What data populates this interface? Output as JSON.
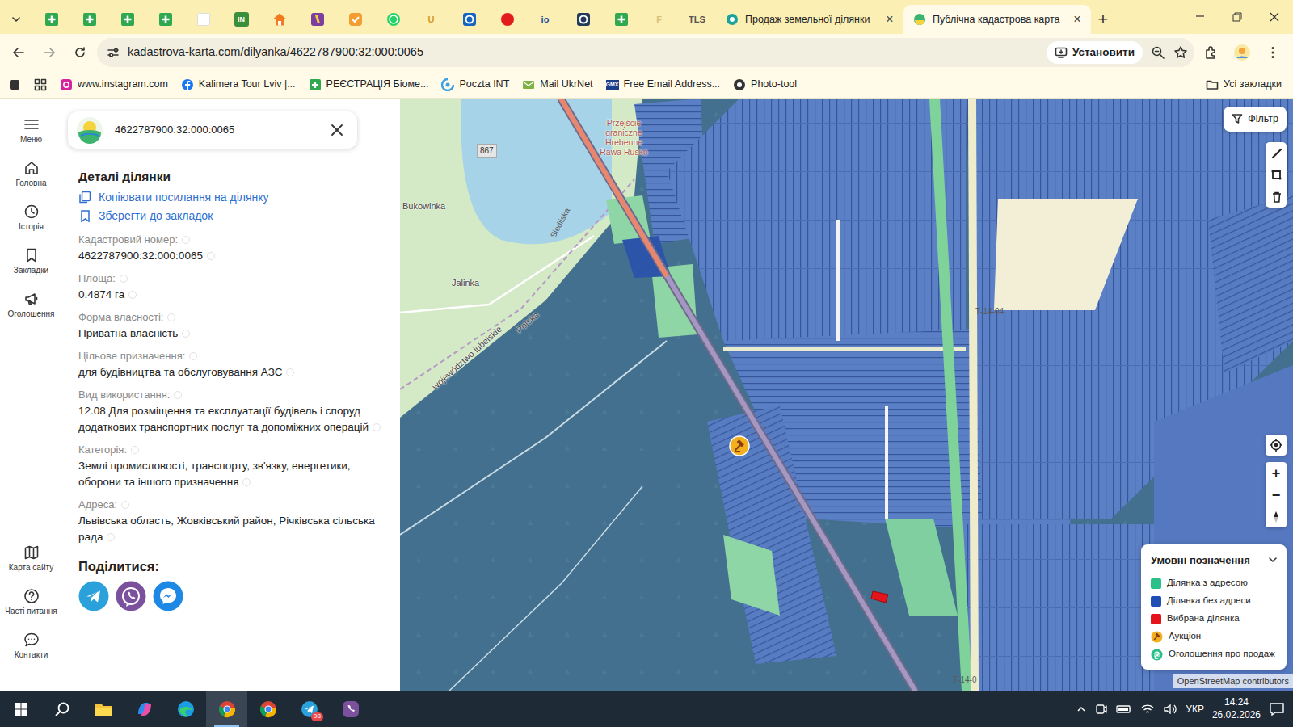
{
  "browser": {
    "pinned_tabs": [
      {
        "kind": "plus",
        "color": "#2fa84f"
      },
      {
        "kind": "plus",
        "color": "#2fa84f"
      },
      {
        "kind": "plus",
        "color": "#2fa84f"
      },
      {
        "kind": "plus",
        "color": "#2fa84f"
      },
      {
        "kind": "blank",
        "color": "#ffffff"
      },
      {
        "kind": "tile",
        "label": "IN",
        "color": "#3a8f3a"
      },
      {
        "kind": "house",
        "color": "#f47a20"
      },
      {
        "kind": "badge",
        "color": "#7b3fa0"
      },
      {
        "kind": "check",
        "color": "#f39c32"
      },
      {
        "kind": "chat",
        "color": "#25d366"
      },
      {
        "kind": "text",
        "label": "U",
        "color": "#d99a1a"
      },
      {
        "kind": "ring",
        "color": "#1565c0"
      },
      {
        "kind": "dot",
        "color": "#e31b1b"
      },
      {
        "kind": "text",
        "label": "io",
        "color": "#1a4fa0"
      },
      {
        "kind": "ring",
        "color": "#233a5a"
      },
      {
        "kind": "plus",
        "color": "#2fa84f"
      },
      {
        "kind": "text",
        "label": "F",
        "color": "#d9c07a"
      },
      {
        "kind": "text",
        "label": "TLS",
        "color": "#555555"
      }
    ],
    "tabs": [
      {
        "label": "Продаж земельної ділянки",
        "close": "×",
        "kind": "sale-site",
        "selected": false
      },
      {
        "label": "Публічна кадастрова карта",
        "close": "×",
        "kind": "cadastre",
        "selected": true
      }
    ],
    "new_tab": "+",
    "address": "kadastrova-karta.com/dilyanka/4622787900:32:000:0065",
    "install_button": "Установити",
    "bookmarks": [
      {
        "label": "www.instagram.com",
        "kind": "instagram",
        "color": "#d6249f"
      },
      {
        "label": "Kalimera Tour Lviv |...",
        "kind": "facebook",
        "color": "#1877f2"
      },
      {
        "label": "РЕЄСТРАЦІЯ Біоме...",
        "kind": "plus",
        "color": "#2fa84f"
      },
      {
        "label": "Poczta INT",
        "kind": "swirl",
        "color": "#3ba0e6"
      },
      {
        "label": "Mail UkrNet",
        "kind": "mail",
        "color": "#7cb342"
      },
      {
        "label": "Free Email Address...",
        "kind": "gmx",
        "icon_text": "GMX",
        "color": "#1c3e8a"
      },
      {
        "label": "Photo-tool",
        "kind": "dark",
        "color": "#333333"
      }
    ],
    "all_bookmarks": "Усі закладки"
  },
  "nav": {
    "top": [
      {
        "label": "Меню",
        "kind": "menu"
      },
      {
        "label": "Головна",
        "kind": "home"
      },
      {
        "label": "Історія",
        "kind": "history"
      },
      {
        "label": "Закладки",
        "kind": "bookmark"
      },
      {
        "label": "Оголошення",
        "kind": "announce"
      }
    ],
    "bottom": [
      {
        "label": "Карта сайту",
        "kind": "sitemap"
      },
      {
        "label": "Часті питання",
        "kind": "faq"
      },
      {
        "label": "Контакти",
        "kind": "contacts"
      }
    ]
  },
  "panel": {
    "search_value": "4622787900:32:000:0065",
    "title": "Деталі ділянки",
    "actions": [
      {
        "label": "Копіювати посилання на ділянку",
        "kind": "copy"
      },
      {
        "label": "Зберегти до закладок",
        "kind": "bookmark"
      }
    ],
    "fields": [
      {
        "label": "Кадастровий номер:",
        "value": "4622787900:32:000:0065"
      },
      {
        "label": "Площа:",
        "value": "0.4874 га"
      },
      {
        "label": "Форма власності:",
        "value": "Приватна власність"
      },
      {
        "label": "Цільове призначення:",
        "value": "для будівництва та обслуговування АЗС"
      },
      {
        "label": "Вид використання:",
        "value": "12.08 Для розміщення та експлуатації будівель і споруд додаткових транспортних послуг та допоміжних операцій"
      },
      {
        "label": "Категорія:",
        "value": "Землі промисловості, транспорту, зв'язку, енергетики, оборони та іншого призначення"
      },
      {
        "label": "Адреса:",
        "value": "Львівська область, Жовківський район, Річківська сільська рада"
      }
    ],
    "share_title": "Поділитися:",
    "share": [
      {
        "kind": "telegram",
        "color": "#2aa1da"
      },
      {
        "kind": "viber",
        "color": "#7b519d"
      },
      {
        "kind": "messenger",
        "color": "#1e88e5"
      }
    ]
  },
  "map": {
    "filter": "Фільтр",
    "zoom_in": "+",
    "zoom_out": "−",
    "labels": [
      {
        "text": "867",
        "kind": "route"
      },
      {
        "text": "Przejście graniczne Hrebenne Rawa Rusko",
        "kind": "poi"
      },
      {
        "text": "Bukowinka",
        "kind": "place"
      },
      {
        "text": "Jalinka",
        "kind": "place"
      },
      {
        "text": "Siedliska",
        "kind": "road"
      },
      {
        "text": "Polska",
        "kind": "border"
      },
      {
        "text": "Т-14-04",
        "kind": "road"
      },
      {
        "text": "Т-14-0",
        "kind": "road"
      },
      {
        "text": "województwo lubelskie",
        "kind": "border"
      }
    ],
    "pins": [
      {
        "kind": "auction"
      },
      {
        "kind": "selected"
      }
    ],
    "legend": {
      "title": "Умовні позначення",
      "expanded": true,
      "items": [
        {
          "label": "Ділянка з адресою",
          "kind": "square",
          "color": "#2bbf8a"
        },
        {
          "label": "Ділянка без адреси",
          "kind": "square",
          "color": "#1f4fb5"
        },
        {
          "label": "Вибрана ділянка",
          "kind": "square",
          "color": "#e5141b"
        },
        {
          "label": "Аукціон",
          "kind": "auction",
          "color": "#f2b01e"
        },
        {
          "label": "Оголошення про продаж",
          "kind": "sale",
          "color": "#2bbf8a"
        }
      ]
    },
    "attribution": "OpenStreetMap contributors"
  },
  "taskbar": {
    "apps": [
      {
        "kind": "explorer",
        "selected": false
      },
      {
        "kind": "copilot",
        "selected": false
      },
      {
        "kind": "edge",
        "selected": false
      },
      {
        "kind": "chrome",
        "selected": true
      },
      {
        "kind": "chrome",
        "selected": false
      },
      {
        "kind": "telegram",
        "selected": false,
        "badge": "98"
      },
      {
        "kind": "viber",
        "selected": false
      }
    ],
    "language": "УКР",
    "time": "14:24",
    "date": "26.02.2026"
  }
}
